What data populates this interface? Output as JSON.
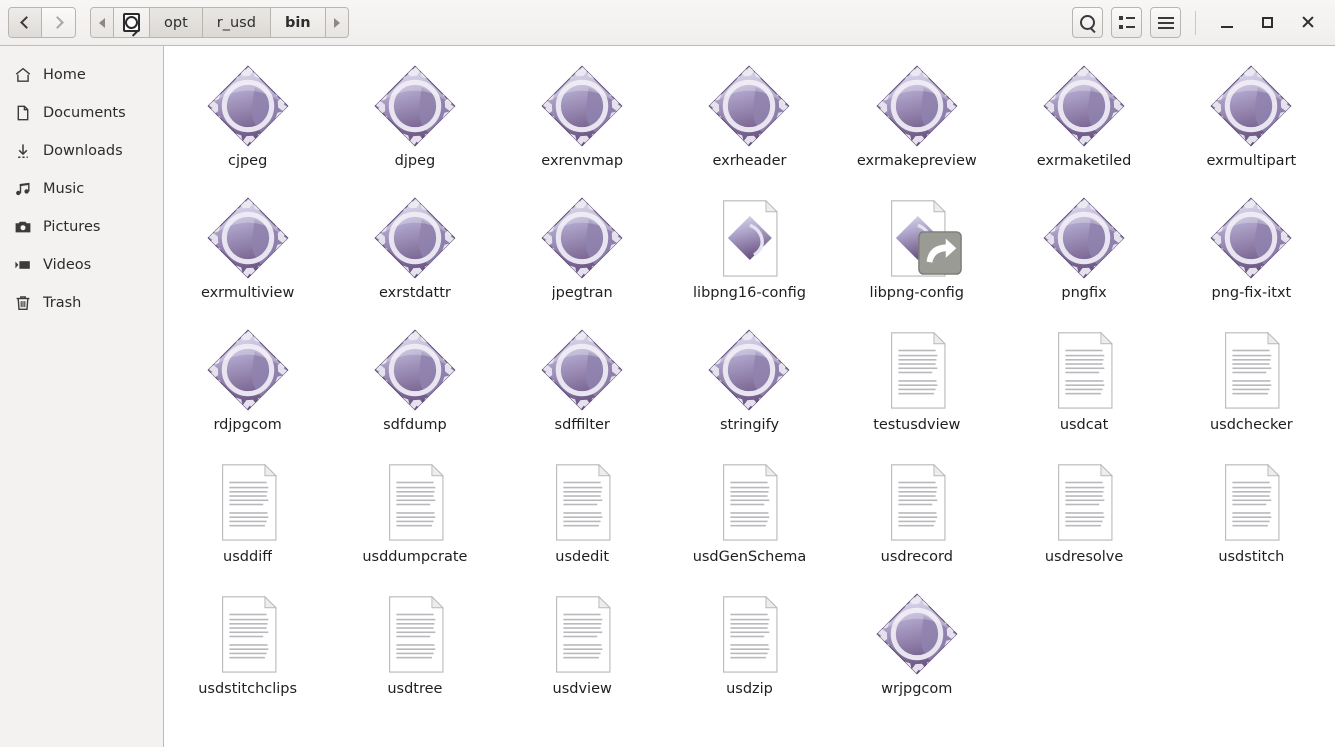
{
  "window": {
    "titlebar": {
      "back_label": "Back",
      "forward_label": "Forward",
      "back_icon": "chevron-left-icon",
      "forward_icon": "chevron-right-icon",
      "path_prev_icon": "triangle-left-icon",
      "path_next_icon": "triangle-right-icon",
      "device_icon": "disk-device-icon",
      "search_icon": "search-icon",
      "listview_icon": "list-view-icon",
      "menu_icon": "hamburger-menu-icon",
      "minimize_icon": "minimize-icon",
      "maximize_icon": "maximize-icon",
      "close_icon": "close-icon"
    },
    "breadcrumbs": [
      {
        "label": "opt",
        "active": false
      },
      {
        "label": "r_usd",
        "active": false
      },
      {
        "label": "bin",
        "active": true
      }
    ]
  },
  "sidebar": {
    "items": [
      {
        "label": "Home",
        "icon": "home-icon"
      },
      {
        "label": "Documents",
        "icon": "document-icon"
      },
      {
        "label": "Downloads",
        "icon": "download-icon"
      },
      {
        "label": "Music",
        "icon": "music-note-icon"
      },
      {
        "label": "Pictures",
        "icon": "camera-icon"
      },
      {
        "label": "Videos",
        "icon": "video-icon"
      },
      {
        "label": "Trash",
        "icon": "trash-icon"
      }
    ]
  },
  "colors": {
    "exec_icon_light": "#cdcbe8",
    "exec_icon_dark": "#6f5a86",
    "exec_icon_mid": "#a59ac4",
    "sidebar_bg": "#f3f2f0",
    "toolbar_bg": "#f1efed",
    "content_bg": "#ffffff",
    "text": "#1f1f1f",
    "emblem_bg": "#9c9c96"
  },
  "files": [
    {
      "name": "cjpeg",
      "type": "executable"
    },
    {
      "name": "djpeg",
      "type": "executable"
    },
    {
      "name": "exrenvmap",
      "type": "executable"
    },
    {
      "name": "exrheader",
      "type": "executable"
    },
    {
      "name": "exrmakepreview",
      "type": "executable"
    },
    {
      "name": "exrmaketiled",
      "type": "executable"
    },
    {
      "name": "exrmultipart",
      "type": "executable"
    },
    {
      "name": "exrmultiview",
      "type": "executable"
    },
    {
      "name": "exrstdattr",
      "type": "executable"
    },
    {
      "name": "jpegtran",
      "type": "executable"
    },
    {
      "name": "libpng16-config",
      "type": "script"
    },
    {
      "name": "libpng-config",
      "type": "script",
      "link": true
    },
    {
      "name": "pngfix",
      "type": "executable"
    },
    {
      "name": "png-fix-itxt",
      "type": "executable"
    },
    {
      "name": "rdjpgcom",
      "type": "executable"
    },
    {
      "name": "sdfdump",
      "type": "executable"
    },
    {
      "name": "sdffilter",
      "type": "executable"
    },
    {
      "name": "stringify",
      "type": "executable"
    },
    {
      "name": "testusdview",
      "type": "text"
    },
    {
      "name": "usdcat",
      "type": "text"
    },
    {
      "name": "usdchecker",
      "type": "text"
    },
    {
      "name": "usddiff",
      "type": "text"
    },
    {
      "name": "usddumpcrate",
      "type": "text"
    },
    {
      "name": "usdedit",
      "type": "text"
    },
    {
      "name": "usdGenSchema",
      "type": "text"
    },
    {
      "name": "usdrecord",
      "type": "text"
    },
    {
      "name": "usdresolve",
      "type": "text"
    },
    {
      "name": "usdstitch",
      "type": "text"
    },
    {
      "name": "usdstitchclips",
      "type": "text"
    },
    {
      "name": "usdtree",
      "type": "text"
    },
    {
      "name": "usdview",
      "type": "text"
    },
    {
      "name": "usdzip",
      "type": "text"
    },
    {
      "name": "wrjpgcom",
      "type": "executable"
    }
  ]
}
